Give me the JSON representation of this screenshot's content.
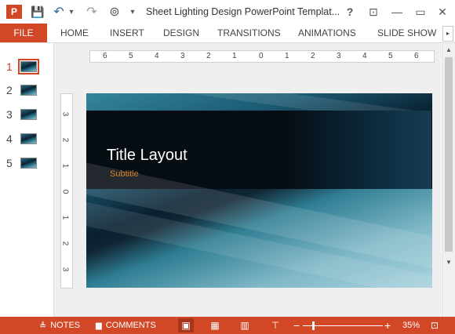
{
  "titlebar": {
    "title": "Sheet Lighting Design PowerPoint Templat...",
    "app_letter": "P",
    "buttons": {
      "save": "💾",
      "undo": "↶",
      "undo_menu": "▾",
      "redo": "↷",
      "presenter": "⊚",
      "customize": "▾",
      "help": "?",
      "ribbon_display": "⊡",
      "minimize": "—",
      "restore": "▭",
      "close": "✕"
    }
  },
  "ribbon": {
    "tabs": [
      "FILE",
      "HOME",
      "INSERT",
      "DESIGN",
      "TRANSITIONS",
      "ANIMATIONS",
      "SLIDE SHOW"
    ],
    "scroll_right": "▸"
  },
  "thumbnails": [
    {
      "number": "1"
    },
    {
      "number": "2"
    },
    {
      "number": "3"
    },
    {
      "number": "4"
    },
    {
      "number": "5"
    }
  ],
  "rulers": {
    "horizontal": [
      "6",
      "5",
      "4",
      "3",
      "2",
      "1",
      "0",
      "1",
      "2",
      "3",
      "4",
      "5",
      "6"
    ],
    "vertical": [
      "3",
      "2",
      "1",
      "0",
      "1",
      "2",
      "3"
    ]
  },
  "slide": {
    "title": "Title Layout",
    "subtitle": "Subtitle"
  },
  "scrollbar": {
    "up": "▲",
    "down": "▼"
  },
  "statusbar": {
    "notes_icon": "≜",
    "notes": "NOTES",
    "comments_icon": "▆",
    "comments": "COMMENTS",
    "views": {
      "normal": "▣",
      "sorter": "▦",
      "reading": "▥",
      "slideshow": "⊤"
    },
    "zoom_out": "−",
    "zoom_in": "+",
    "zoom_level": "35%",
    "fit": "⊡"
  },
  "colors": {
    "accent": "#d24726"
  }
}
